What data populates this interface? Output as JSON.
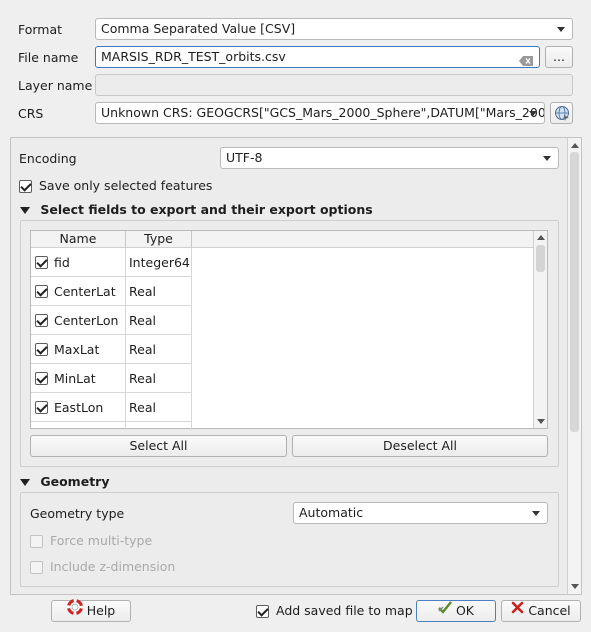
{
  "top": {
    "format_label": "Format",
    "format_value": "Comma Separated Value [CSV]",
    "filename_label": "File name",
    "filename_value": "MARSIS_RDR_TEST_orbits.csv",
    "browse_label": "...",
    "layername_label": "Layer name",
    "layername_value": "",
    "crs_label": "CRS",
    "crs_value": "Unknown CRS: GEOGCRS[\"GCS_Mars_2000_Sphere\",DATUM[\"Mars_200"
  },
  "options": {
    "encoding_label": "Encoding",
    "encoding_value": "UTF-8",
    "save_selected_label": "Save only selected features",
    "save_selected_checked": true
  },
  "fields_section": {
    "title": "Select fields to export and their export options",
    "columns": [
      "Name",
      "Type"
    ],
    "rows": [
      {
        "name": "fid",
        "type": "Integer64",
        "checked": true
      },
      {
        "name": "CenterLat",
        "type": "Real",
        "checked": true
      },
      {
        "name": "CenterLon",
        "type": "Real",
        "checked": true
      },
      {
        "name": "MaxLat",
        "type": "Real",
        "checked": true
      },
      {
        "name": "MinLat",
        "type": "Real",
        "checked": true
      },
      {
        "name": "EastLon",
        "type": "Real",
        "checked": true
      }
    ],
    "select_all_label": "Select All",
    "deselect_all_label": "Deselect All"
  },
  "geometry_section": {
    "title": "Geometry",
    "type_label": "Geometry type",
    "type_value": "Automatic",
    "force_multi_label": "Force multi-type",
    "include_z_label": "Include z-dimension"
  },
  "bottom": {
    "help_label": "Help",
    "add_saved_label": "Add saved file to map",
    "add_saved_checked": true,
    "ok_label": "OK",
    "cancel_label": "Cancel"
  },
  "icons": {
    "clear": "clear-text-icon",
    "crs": "crs-globe-icon",
    "help": "help-lifebuoy-icon",
    "ok": "ok-check-icon",
    "cancel": "cancel-x-icon"
  },
  "colors": {
    "focus_border": "#3b78c2",
    "cancel_icon": "#cc2222",
    "ok_icon": "#5a8a2a"
  }
}
